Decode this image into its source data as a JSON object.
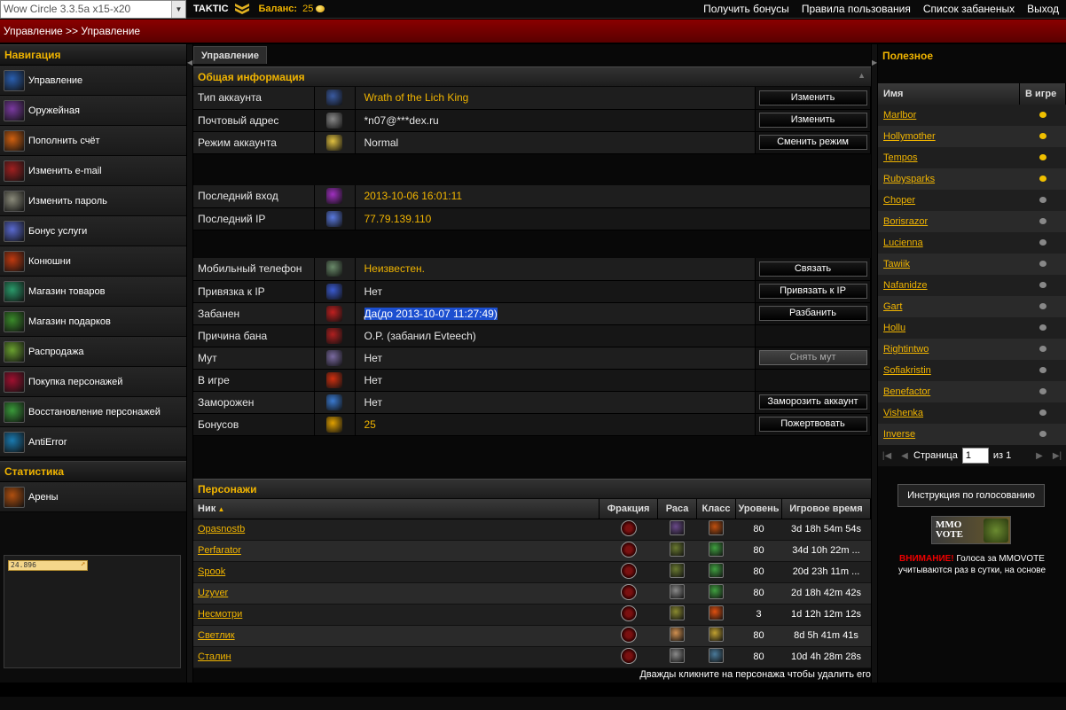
{
  "topbar": {
    "realm": "Wow Circle 3.3.5a x15-x20",
    "brand": "TAKTIC",
    "balance_label": "Баланс:",
    "balance_value": "25",
    "links": [
      "Получить бонусы",
      "Правила пользования",
      "Список забаненых",
      "Выход"
    ]
  },
  "breadcrumb": "Управление >> Управление",
  "nav": {
    "title": "Навигация",
    "items": [
      {
        "label": "Управление",
        "icon": "management-icon",
        "color": "#2a5fb0"
      },
      {
        "label": "Оружейная",
        "icon": "armory-icon",
        "color": "#7a3aa0"
      },
      {
        "label": "Пополнить счёт",
        "icon": "fire-icon",
        "color": "#d06010"
      },
      {
        "label": "Изменить e-mail",
        "icon": "email-icon",
        "color": "#a02020"
      },
      {
        "label": "Изменить пароль",
        "icon": "password-icon",
        "color": "#8a8a7a"
      },
      {
        "label": "Бонус услуги",
        "icon": "bonus-icon",
        "color": "#5a6ad0"
      },
      {
        "label": "Конюшни",
        "icon": "stable-icon",
        "color": "#c03a10"
      },
      {
        "label": "Магазин товаров",
        "icon": "shop-icon",
        "color": "#2a9a6a"
      },
      {
        "label": "Магазин подарков",
        "icon": "gift-shop-icon",
        "color": "#3a8a2a"
      },
      {
        "label": "Распродажа",
        "icon": "sale-icon",
        "color": "#6aa030"
      },
      {
        "label": "Покупка персонажей",
        "icon": "buy-character-icon",
        "color": "#a01030"
      },
      {
        "label": "Восстановление персонажей",
        "icon": "restore-character-icon",
        "color": "#3a9a3a"
      },
      {
        "label": "AntiError",
        "icon": "antierror-icon",
        "color": "#1a7ab0"
      }
    ],
    "stats_title": "Статистика",
    "stats_items": [
      {
        "label": "Арены",
        "icon": "arena-icon",
        "color": "#b05010"
      }
    ],
    "counter": "24.896"
  },
  "main": {
    "tab": "Управление",
    "general_title": "Общая информация",
    "group1": [
      {
        "label": "Тип аккаунта",
        "value": "Wrath of the Lich King",
        "gold": true,
        "button": "Изменить",
        "icon": "wrath-logo-icon",
        "color": "#3a5aa0"
      },
      {
        "label": "Почтовый адрес",
        "value": "*n07@***dex.ru",
        "gold": false,
        "button": "Изменить",
        "icon": "mail-icon",
        "color": "#888888"
      },
      {
        "label": "Режим аккаунта",
        "value": "Normal",
        "gold": false,
        "button": "Сменить режим",
        "icon": "star-icon",
        "color": "#e0c040"
      }
    ],
    "group2": [
      {
        "label": "Последний вход",
        "value": "2013-10-06 16:01:11",
        "gold": true,
        "icon": "login-icon",
        "color": "#a030c0"
      },
      {
        "label": "Последний IP",
        "value": "77.79.139.110",
        "gold": true,
        "icon": "ip-icon",
        "color": "#5a7ae0"
      }
    ],
    "group3": [
      {
        "label": "Мобильный телефон",
        "value": "Неизвестен.",
        "gold": true,
        "button": "Связать",
        "icon": "phone-icon",
        "color": "#6a8a6a"
      },
      {
        "label": "Привязка к IP",
        "value": "Нет",
        "gold": false,
        "button": "Привязать к IP",
        "icon": "shield-icon",
        "color": "#3a5ad0"
      },
      {
        "label": "Забанен",
        "value": "Да(до 2013-10-07 11:27:49)",
        "gold": false,
        "highlight": true,
        "button": "Разбанить",
        "icon": "ban-icon",
        "color": "#c02020"
      },
      {
        "label": "Причина бана",
        "value": "O.P. (забанил Evteech)",
        "gold": false,
        "icon": "ban-reason-icon",
        "color": "#b02020"
      },
      {
        "label": "Мут",
        "value": "Нет",
        "gold": false,
        "button": "Снять мут",
        "disabled": true,
        "icon": "mute-icon",
        "color": "#7a6aa0"
      },
      {
        "label": "В игре",
        "value": "Нет",
        "gold": false,
        "icon": "in-game-icon",
        "color": "#d03010"
      },
      {
        "label": "Заморожен",
        "value": "Нет",
        "gold": false,
        "button": "Заморозить аккаунт",
        "icon": "freeze-icon",
        "color": "#3a7ad0"
      },
      {
        "label": "Бонусов",
        "value": "25",
        "gold": true,
        "button": "Пожертвовать",
        "icon": "coin-icon",
        "color": "#e0a000"
      }
    ],
    "chars_title": "Персонажи",
    "chars_headers": [
      "Ник",
      "Фракция",
      "Раса",
      "Класс",
      "Уровень",
      "Игровое время"
    ],
    "chars": [
      {
        "name": "Opasnostb",
        "level": "80",
        "time": "3d 18h 54m 54s",
        "race": "#6a4a8a",
        "cls": "#c05010"
      },
      {
        "name": "Perfarator",
        "level": "80",
        "time": "34d 10h 22m ...",
        "race": "#6a7a30",
        "cls": "#40a040"
      },
      {
        "name": "Spook",
        "level": "80",
        "time": "20d 23h 11m ...",
        "race": "#6a7a30",
        "cls": "#40a040"
      },
      {
        "name": "Uzyver",
        "level": "80",
        "time": "2d 18h 42m 42s",
        "race": "#8a8a8a",
        "cls": "#40a040"
      },
      {
        "name": "Несмотри",
        "level": "3",
        "time": "1d 12h 12m 12s",
        "race": "#8a8a30",
        "cls": "#e05010"
      },
      {
        "name": "Светлик",
        "level": "80",
        "time": "8d 5h 41m 41s",
        "race": "#d09050",
        "cls": "#c0a030"
      },
      {
        "name": "Сталин",
        "level": "80",
        "time": "10d 4h 28m 28s",
        "race": "#8a8a8a",
        "cls": "#4a7a9a"
      }
    ],
    "hint": "Дважды кликните на персонажа чтобы удалить его"
  },
  "useful": {
    "title": "Полезное",
    "headers": [
      "Имя",
      "В игре"
    ],
    "rows": [
      {
        "name": "Marlbor",
        "online": true
      },
      {
        "name": "Hollymother",
        "online": true
      },
      {
        "name": "Tempos",
        "online": true
      },
      {
        "name": "Rubysparks",
        "online": true
      },
      {
        "name": "Choper",
        "online": false
      },
      {
        "name": "Borisrazor",
        "online": false
      },
      {
        "name": "Lucienna",
        "online": false
      },
      {
        "name": "Tawiik",
        "online": false
      },
      {
        "name": "Nafanidze",
        "online": false
      },
      {
        "name": "Gart",
        "online": false
      },
      {
        "name": "Hollu",
        "online": false
      },
      {
        "name": "Rightintwo",
        "online": false
      },
      {
        "name": "Sofiakristin",
        "online": false
      },
      {
        "name": "Benefactor",
        "online": false
      },
      {
        "name": "Vishenka",
        "online": false
      },
      {
        "name": "Inverse",
        "online": false
      }
    ],
    "pager": {
      "label": "Страница",
      "page": "1",
      "of": "из 1"
    },
    "vote_button": "Инструкция по голосованию",
    "mmo_line1": "MMO",
    "mmo_line2": "VOTE",
    "warn_prefix": "ВНИМАНИЕ!",
    "warn_text": " Голоса за MMOVOTE учитываются раз в сутки, на основе"
  },
  "colors": {
    "accent": "#f0b400",
    "red": "#8a0000",
    "online": "#f0c000",
    "offline": "#888888"
  }
}
